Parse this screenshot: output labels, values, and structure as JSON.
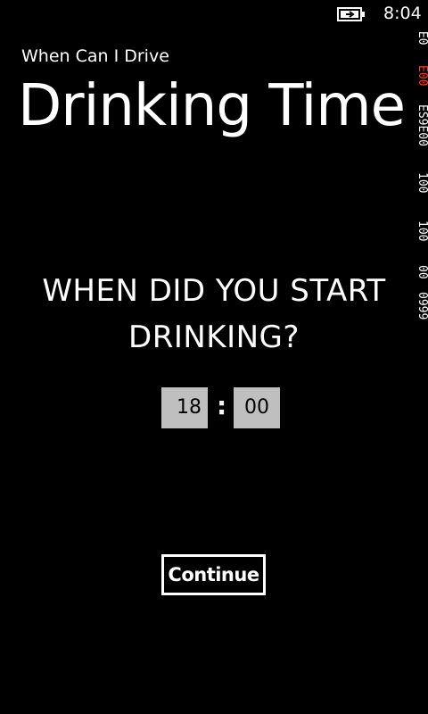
{
  "status_bar": {
    "time": "8:04",
    "battery_icon": "battery-charging-icon"
  },
  "frame_counter": {
    "values": [
      "0999",
      "00",
      "100",
      "100",
      "ES9E00",
      "E00",
      "2E0"
    ],
    "highlight_color": "#ff3b1f",
    "text_color": "#ffffff"
  },
  "app": {
    "title": "When Can I Drive",
    "page_title": "Drinking Time"
  },
  "question": {
    "line1": "WHEN DID YOU START",
    "line2": "DRINKING?"
  },
  "time_picker": {
    "hour": "18",
    "separator": ":",
    "minute": "00"
  },
  "actions": {
    "continue_label": "Continue"
  },
  "colors": {
    "background": "#000000",
    "foreground": "#ffffff",
    "picker_bg": "#bfbfbf"
  }
}
